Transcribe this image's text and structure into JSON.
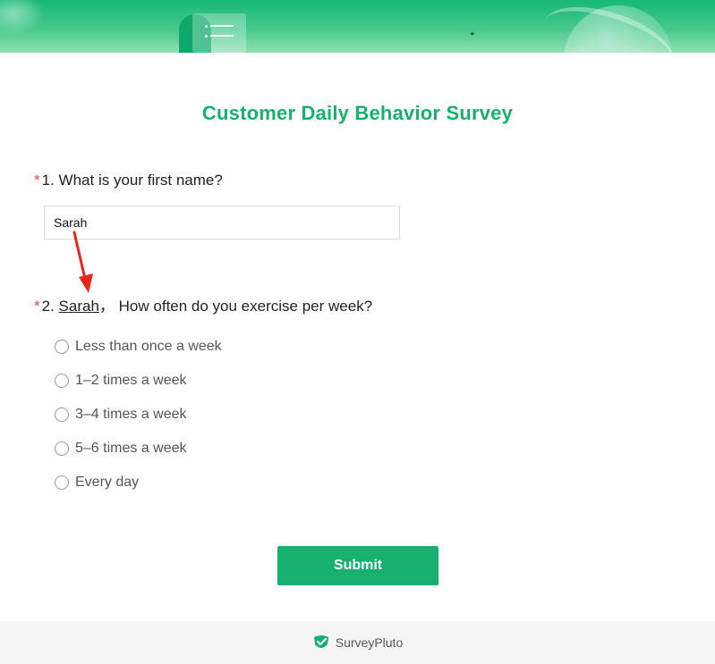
{
  "survey": {
    "title": "Customer Daily Behavior Survey"
  },
  "questions": [
    {
      "required_mark": "*",
      "number": "1.",
      "text": "What is your first name?",
      "answer_value": "Sarah"
    },
    {
      "required_mark": "*",
      "number": "2.",
      "piped_name": "Sarah",
      "separator": "，",
      "text": "How often do you exercise per week?",
      "options": [
        {
          "label": "Less than once a week",
          "selected": false
        },
        {
          "label": "1–2 times a week",
          "selected": false
        },
        {
          "label": "3–4 times a week",
          "selected": false
        },
        {
          "label": "5–6 times a week",
          "selected": false
        },
        {
          "label": "Every day",
          "selected": false
        }
      ]
    }
  ],
  "submit": {
    "label": "Submit"
  },
  "footer": {
    "brand": "SurveyPluto"
  },
  "colors": {
    "accent": "#17b06e",
    "required": "#e8453c",
    "annotation_arrow": "#e8261c"
  },
  "icons": {
    "banner": "survey-clipboard-illustration",
    "footer_logo": "checkmark-shield-icon",
    "annotation": "red-arrow-annotation"
  }
}
